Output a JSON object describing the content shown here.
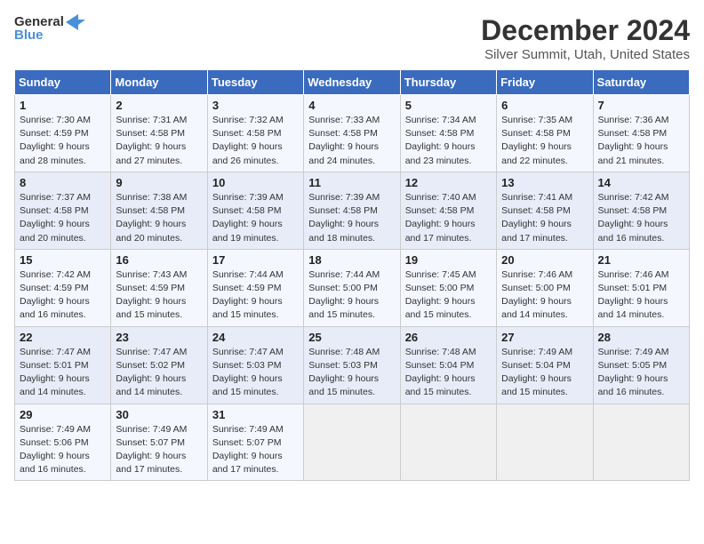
{
  "header": {
    "logo_line1": "General",
    "logo_line2": "Blue",
    "month": "December 2024",
    "location": "Silver Summit, Utah, United States"
  },
  "days_of_week": [
    "Sunday",
    "Monday",
    "Tuesday",
    "Wednesday",
    "Thursday",
    "Friday",
    "Saturday"
  ],
  "weeks": [
    [
      {
        "day": "1",
        "sunrise": "Sunrise: 7:30 AM",
        "sunset": "Sunset: 4:59 PM",
        "daylight": "Daylight: 9 hours and 28 minutes."
      },
      {
        "day": "2",
        "sunrise": "Sunrise: 7:31 AM",
        "sunset": "Sunset: 4:58 PM",
        "daylight": "Daylight: 9 hours and 27 minutes."
      },
      {
        "day": "3",
        "sunrise": "Sunrise: 7:32 AM",
        "sunset": "Sunset: 4:58 PM",
        "daylight": "Daylight: 9 hours and 26 minutes."
      },
      {
        "day": "4",
        "sunrise": "Sunrise: 7:33 AM",
        "sunset": "Sunset: 4:58 PM",
        "daylight": "Daylight: 9 hours and 24 minutes."
      },
      {
        "day": "5",
        "sunrise": "Sunrise: 7:34 AM",
        "sunset": "Sunset: 4:58 PM",
        "daylight": "Daylight: 9 hours and 23 minutes."
      },
      {
        "day": "6",
        "sunrise": "Sunrise: 7:35 AM",
        "sunset": "Sunset: 4:58 PM",
        "daylight": "Daylight: 9 hours and 22 minutes."
      },
      {
        "day": "7",
        "sunrise": "Sunrise: 7:36 AM",
        "sunset": "Sunset: 4:58 PM",
        "daylight": "Daylight: 9 hours and 21 minutes."
      }
    ],
    [
      {
        "day": "8",
        "sunrise": "Sunrise: 7:37 AM",
        "sunset": "Sunset: 4:58 PM",
        "daylight": "Daylight: 9 hours and 20 minutes."
      },
      {
        "day": "9",
        "sunrise": "Sunrise: 7:38 AM",
        "sunset": "Sunset: 4:58 PM",
        "daylight": "Daylight: 9 hours and 20 minutes."
      },
      {
        "day": "10",
        "sunrise": "Sunrise: 7:39 AM",
        "sunset": "Sunset: 4:58 PM",
        "daylight": "Daylight: 9 hours and 19 minutes."
      },
      {
        "day": "11",
        "sunrise": "Sunrise: 7:39 AM",
        "sunset": "Sunset: 4:58 PM",
        "daylight": "Daylight: 9 hours and 18 minutes."
      },
      {
        "day": "12",
        "sunrise": "Sunrise: 7:40 AM",
        "sunset": "Sunset: 4:58 PM",
        "daylight": "Daylight: 9 hours and 17 minutes."
      },
      {
        "day": "13",
        "sunrise": "Sunrise: 7:41 AM",
        "sunset": "Sunset: 4:58 PM",
        "daylight": "Daylight: 9 hours and 17 minutes."
      },
      {
        "day": "14",
        "sunrise": "Sunrise: 7:42 AM",
        "sunset": "Sunset: 4:58 PM",
        "daylight": "Daylight: 9 hours and 16 minutes."
      }
    ],
    [
      {
        "day": "15",
        "sunrise": "Sunrise: 7:42 AM",
        "sunset": "Sunset: 4:59 PM",
        "daylight": "Daylight: 9 hours and 16 minutes."
      },
      {
        "day": "16",
        "sunrise": "Sunrise: 7:43 AM",
        "sunset": "Sunset: 4:59 PM",
        "daylight": "Daylight: 9 hours and 15 minutes."
      },
      {
        "day": "17",
        "sunrise": "Sunrise: 7:44 AM",
        "sunset": "Sunset: 4:59 PM",
        "daylight": "Daylight: 9 hours and 15 minutes."
      },
      {
        "day": "18",
        "sunrise": "Sunrise: 7:44 AM",
        "sunset": "Sunset: 5:00 PM",
        "daylight": "Daylight: 9 hours and 15 minutes."
      },
      {
        "day": "19",
        "sunrise": "Sunrise: 7:45 AM",
        "sunset": "Sunset: 5:00 PM",
        "daylight": "Daylight: 9 hours and 15 minutes."
      },
      {
        "day": "20",
        "sunrise": "Sunrise: 7:46 AM",
        "sunset": "Sunset: 5:00 PM",
        "daylight": "Daylight: 9 hours and 14 minutes."
      },
      {
        "day": "21",
        "sunrise": "Sunrise: 7:46 AM",
        "sunset": "Sunset: 5:01 PM",
        "daylight": "Daylight: 9 hours and 14 minutes."
      }
    ],
    [
      {
        "day": "22",
        "sunrise": "Sunrise: 7:47 AM",
        "sunset": "Sunset: 5:01 PM",
        "daylight": "Daylight: 9 hours and 14 minutes."
      },
      {
        "day": "23",
        "sunrise": "Sunrise: 7:47 AM",
        "sunset": "Sunset: 5:02 PM",
        "daylight": "Daylight: 9 hours and 14 minutes."
      },
      {
        "day": "24",
        "sunrise": "Sunrise: 7:47 AM",
        "sunset": "Sunset: 5:03 PM",
        "daylight": "Daylight: 9 hours and 15 minutes."
      },
      {
        "day": "25",
        "sunrise": "Sunrise: 7:48 AM",
        "sunset": "Sunset: 5:03 PM",
        "daylight": "Daylight: 9 hours and 15 minutes."
      },
      {
        "day": "26",
        "sunrise": "Sunrise: 7:48 AM",
        "sunset": "Sunset: 5:04 PM",
        "daylight": "Daylight: 9 hours and 15 minutes."
      },
      {
        "day": "27",
        "sunrise": "Sunrise: 7:49 AM",
        "sunset": "Sunset: 5:04 PM",
        "daylight": "Daylight: 9 hours and 15 minutes."
      },
      {
        "day": "28",
        "sunrise": "Sunrise: 7:49 AM",
        "sunset": "Sunset: 5:05 PM",
        "daylight": "Daylight: 9 hours and 16 minutes."
      }
    ],
    [
      {
        "day": "29",
        "sunrise": "Sunrise: 7:49 AM",
        "sunset": "Sunset: 5:06 PM",
        "daylight": "Daylight: 9 hours and 16 minutes."
      },
      {
        "day": "30",
        "sunrise": "Sunrise: 7:49 AM",
        "sunset": "Sunset: 5:07 PM",
        "daylight": "Daylight: 9 hours and 17 minutes."
      },
      {
        "day": "31",
        "sunrise": "Sunrise: 7:49 AM",
        "sunset": "Sunset: 5:07 PM",
        "daylight": "Daylight: 9 hours and 17 minutes."
      },
      null,
      null,
      null,
      null
    ]
  ]
}
